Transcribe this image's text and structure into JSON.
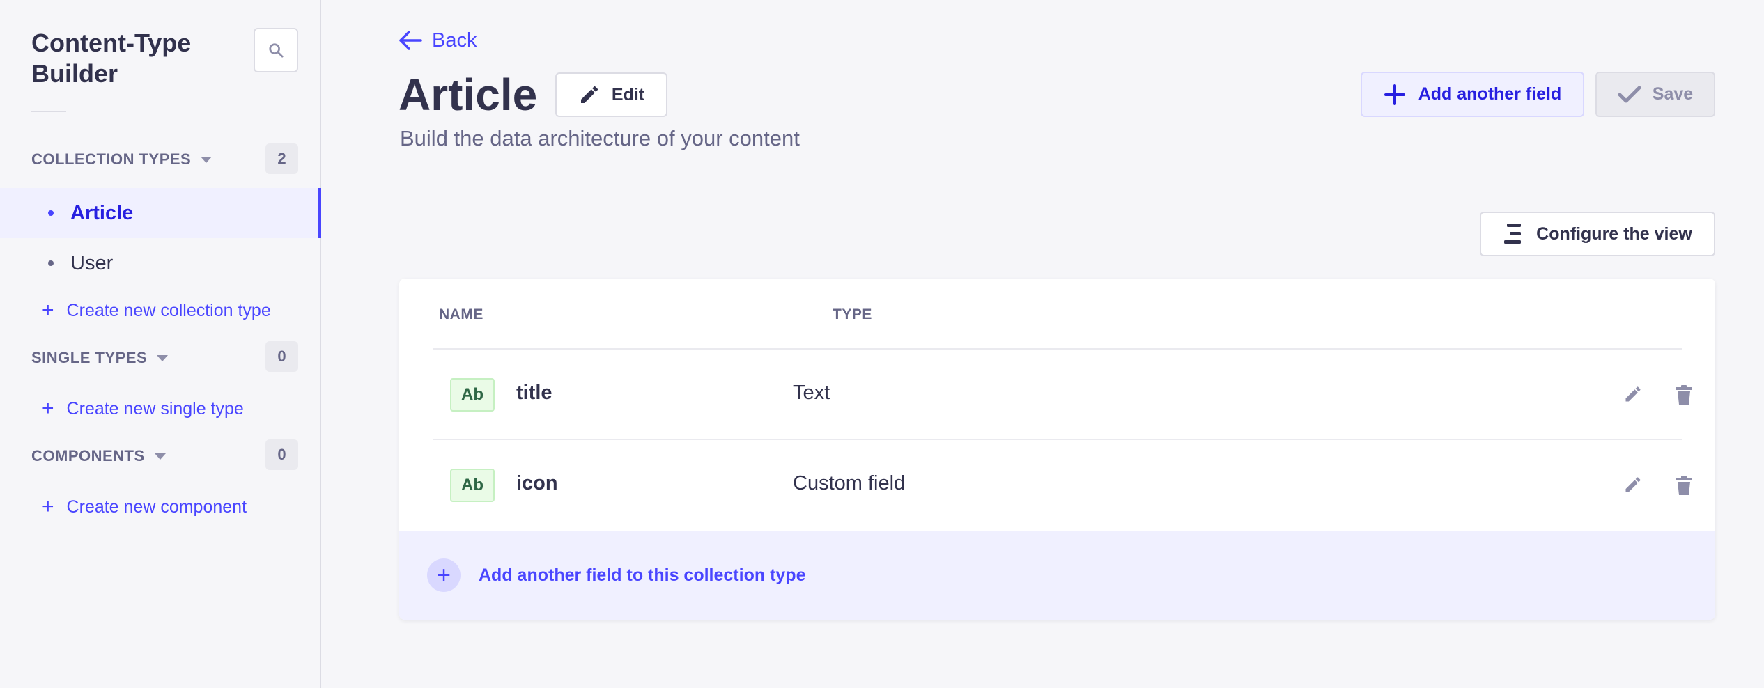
{
  "sidebar": {
    "title": "Content-Type Builder",
    "sections": {
      "collection": {
        "label": "COLLECTION TYPES",
        "count": "2",
        "items": [
          "Article",
          "User"
        ],
        "create_label": "Create new collection type"
      },
      "single": {
        "label": "SINGLE TYPES",
        "count": "0",
        "create_label": "Create new single type"
      },
      "components": {
        "label": "COMPONENTS",
        "count": "0",
        "create_label": "Create new component"
      }
    }
  },
  "header": {
    "back_label": "Back",
    "title": "Article",
    "edit_label": "Edit",
    "subtitle": "Build the data architecture of your content",
    "add_field_label": "Add another field",
    "save_label": "Save",
    "configure_label": "Configure the view"
  },
  "table": {
    "columns": [
      "NAME",
      "TYPE"
    ],
    "rows": [
      {
        "badge": "Ab",
        "name": "title",
        "type": "Text"
      },
      {
        "badge": "Ab",
        "name": "icon",
        "type": "Custom field"
      }
    ],
    "add_label": "Add another field to this collection type"
  },
  "colors": {
    "primary": "#4945ff",
    "active_bg": "#f0f0ff",
    "text": "#32324d",
    "muted": "#666687"
  }
}
